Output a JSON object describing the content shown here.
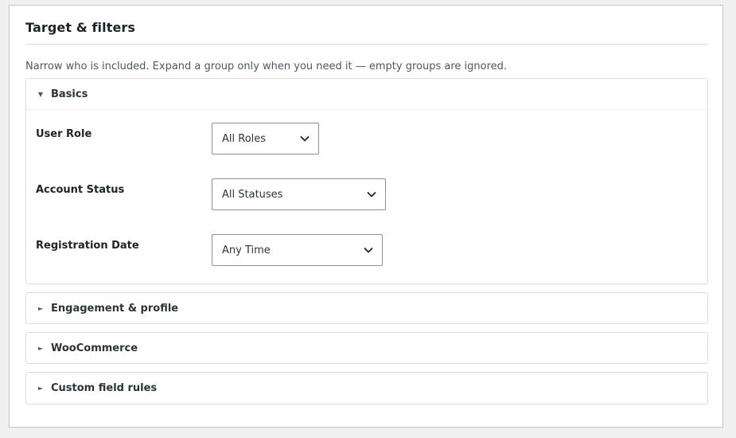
{
  "section": {
    "title": "Target & filters",
    "intro": "Narrow who is included. Expand a group only when you need it — empty groups are ignored."
  },
  "groups": [
    {
      "label": "Basics",
      "expanded": true,
      "fields": [
        {
          "label": "User Role",
          "value": "All Roles"
        },
        {
          "label": "Account Status",
          "value": "All Statuses"
        },
        {
          "label": "Registration Date",
          "value": "Any Time"
        }
      ]
    },
    {
      "label": "Engagement & profile",
      "expanded": false
    },
    {
      "label": "WooCommerce",
      "expanded": false
    },
    {
      "label": "Custom field rules",
      "expanded": false
    }
  ],
  "icons": {
    "expanded_caret": "triangle-down",
    "collapsed_caret": "triangle-right",
    "select_chevron": "chevron-down"
  },
  "colors": {
    "background": "#f0f0f1",
    "panel": "#ffffff",
    "border": "#dcdcde",
    "input_border": "#8c8f94",
    "text": "#1d2327",
    "muted_text": "#50575e"
  }
}
